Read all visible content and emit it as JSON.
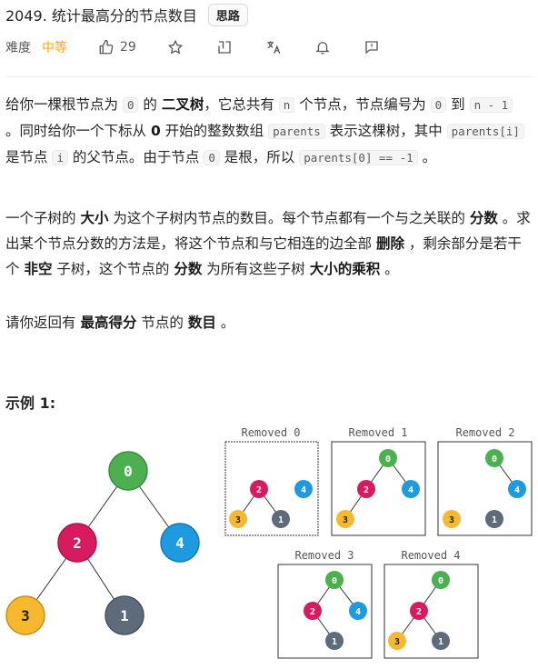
{
  "problem": {
    "title": "2049. 统计最高分的节点数目",
    "tag": "思路"
  },
  "meta": {
    "difficulty_label": "难度",
    "difficulty": "中等",
    "likes": "29"
  },
  "desc": {
    "p1": [
      "给你一棵根节点为 ",
      "0",
      " 的 ",
      "二叉树",
      "，它总共有 ",
      "n",
      " 个节点，节点编号为 ",
      "0",
      " 到 ",
      "n - 1",
      " 。同时给你一个下标从 ",
      "0",
      " 开始的整数数组 ",
      "parents",
      " 表示这棵树，其中 ",
      "parents[i]",
      " 是节点 ",
      "i",
      " 的父节点。由于节点 ",
      "0",
      " 是根，所以 ",
      "parents[0] == -1",
      " 。"
    ],
    "p2": [
      "一个子树的 ",
      "大小",
      " 为这个子树内节点的数目。每个节点都有一个与之关联的 ",
      "分数",
      " 。求出某个节点分数的方法是，将这个节点和与它相连的边全部 ",
      "删除",
      " ，剩余部分是若干个 ",
      "非空",
      " 子树，这个节点的 ",
      "分数",
      " 为所有这些子树 ",
      "大小的乘积",
      " 。"
    ],
    "p3": [
      "请你返回有 ",
      "最高得分",
      " 节点的 ",
      "数目",
      " 。"
    ]
  },
  "example": {
    "title": "示例 1:",
    "nodes": [
      "0",
      "2",
      "4",
      "3",
      "1"
    ],
    "panels": [
      "Removed 0",
      "Removed 1",
      "Removed 2",
      "Removed 3",
      "Removed 4"
    ]
  },
  "colors": {
    "green": "#4caf50",
    "pink": "#d81b60",
    "blue": "#1e9be0",
    "orange": "#f5b82e",
    "slate": "#5d6b7a",
    "accent": "#ffa116"
  },
  "icons": [
    "thumb-up-icon",
    "star-icon",
    "share-icon",
    "translate-icon",
    "bell-icon",
    "report-icon"
  ]
}
